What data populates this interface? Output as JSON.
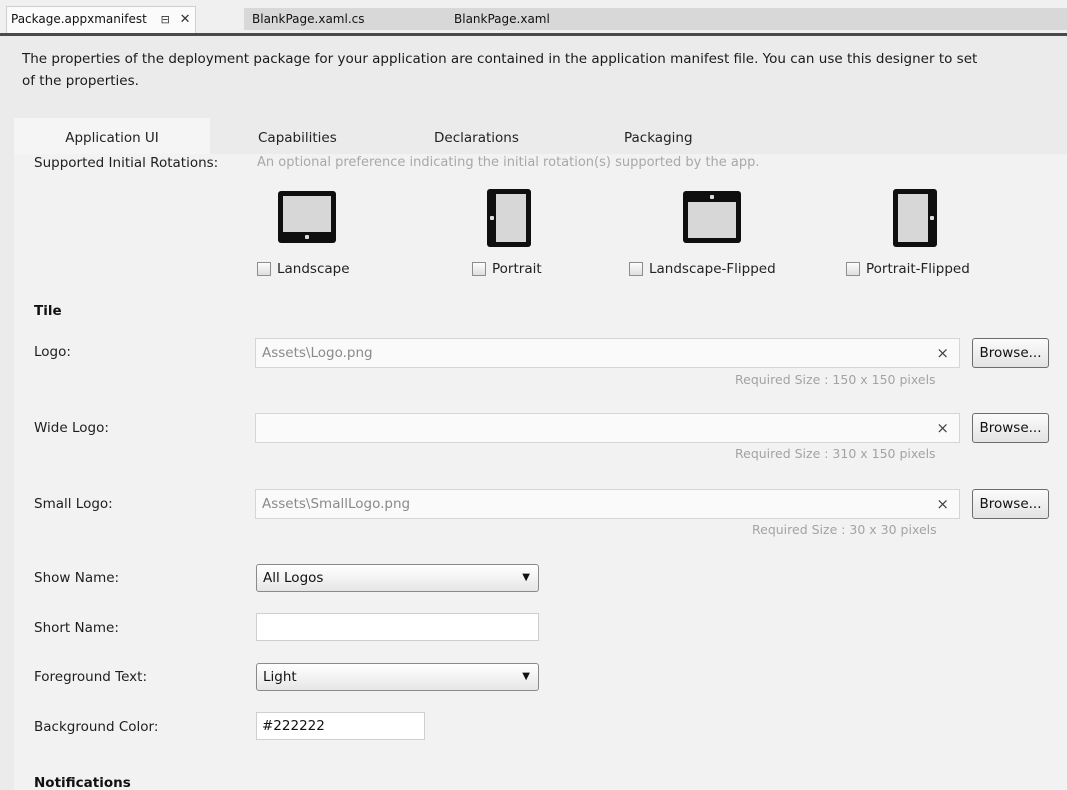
{
  "doc_tabs": {
    "active": "Package.appxmanifest",
    "pin_glyph": "⊟",
    "close_glyph": "✕",
    "tab2": "BlankPage.xaml.cs",
    "tab3": "BlankPage.xaml"
  },
  "intro": {
    "line1": "The properties of the deployment package for your application are contained in the application manifest file. You can use this designer to set",
    "line2": "of the properties."
  },
  "property_tabs": [
    "Application UI",
    "Capabilities",
    "Declarations",
    "Packaging"
  ],
  "rotations": {
    "label": "Supported Initial Rotations:",
    "hint": "An optional preference indicating the initial rotation(s) supported by the app.",
    "options": [
      {
        "label": "Landscape",
        "checked": false
      },
      {
        "label": "Portrait",
        "checked": false
      },
      {
        "label": "Landscape-Flipped",
        "checked": false
      },
      {
        "label": "Portrait-Flipped",
        "checked": false
      }
    ]
  },
  "tile": {
    "heading": "Tile",
    "clear_glyph": "×",
    "browse_label": "Browse...",
    "logo": {
      "label": "Logo:",
      "value": "Assets\\Logo.png",
      "required": "Required Size : 150 x 150 pixels"
    },
    "wide_logo": {
      "label": "Wide Logo:",
      "value": "",
      "required": "Required Size : 310 x 150 pixels"
    },
    "small_logo": {
      "label": "Small Logo:",
      "value": "Assets\\SmallLogo.png",
      "required": "Required Size : 30 x 30 pixels"
    },
    "show_name": {
      "label": "Show Name:",
      "value": "All Logos",
      "caret": "▼"
    },
    "short_name": {
      "label": "Short Name:",
      "value": ""
    },
    "foreground_text": {
      "label": "Foreground Text:",
      "value": "Light",
      "caret": "▼"
    },
    "background_color": {
      "label": "Background Color:",
      "value": "#222222"
    }
  },
  "notifications": {
    "heading": "Notifications"
  }
}
